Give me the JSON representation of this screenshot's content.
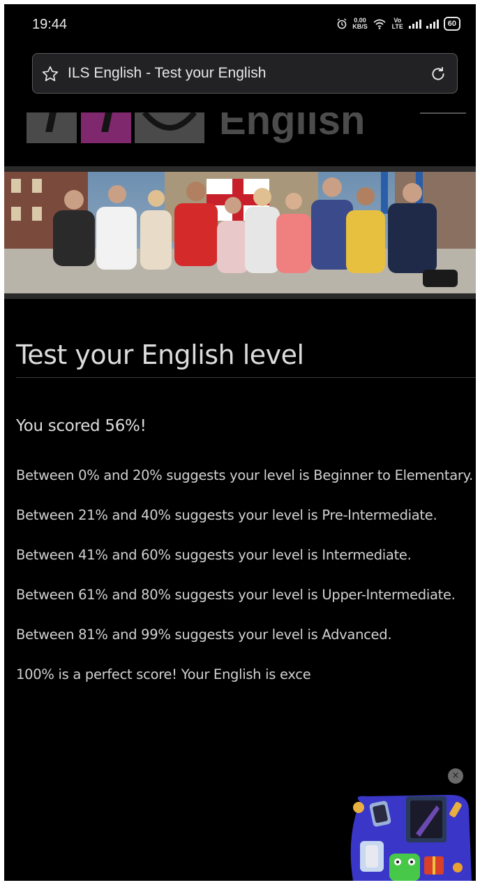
{
  "status_bar": {
    "time": "19:44",
    "net_speed_value": "0.00",
    "net_speed_unit": "KB/S",
    "volte": "Vo LTE",
    "battery": "60"
  },
  "browser": {
    "page_title": "ILS English - Test your English"
  },
  "logo": {
    "word": "English"
  },
  "main": {
    "title": "Test your English level",
    "score_text": "You scored 56%!",
    "levels": [
      "Between 0% and 20% suggests your level is Beginner to Elementary.",
      "Between 21% and 40% suggests your level is Pre-Intermediate.",
      "Between 41% and 60% suggests your level is Intermediate.",
      "Between 61% and 80% suggests your level is Upper-Intermediate.",
      "Between 81% and 99% suggests your level is Advanced.",
      "100% is a perfect score! Your English is exce"
    ]
  },
  "ad": {
    "close_label": "×"
  },
  "colors": {
    "page_bg": "#000000",
    "logo_accent": "#80286d",
    "url_bar_bg": "#222224",
    "text": "#d6d6d6"
  }
}
